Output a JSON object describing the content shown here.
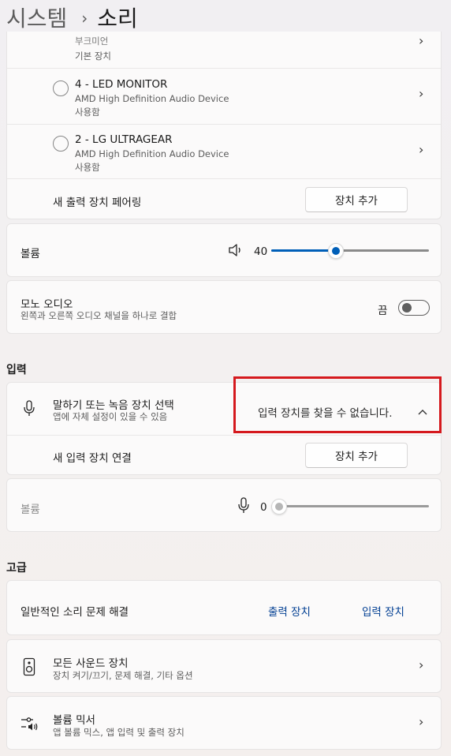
{
  "breadcrumb": {
    "parent": "시스템",
    "separator": "›",
    "current": "소리"
  },
  "output_devices": [
    {
      "name": "부크미언",
      "description": "기본 장치",
      "status": ""
    },
    {
      "name": "4 - LED MONITOR",
      "description": "AMD High Definition Audio Device",
      "status": "사용함"
    },
    {
      "name": "2 - LG ULTRAGEAR",
      "description": "AMD High Definition Audio Device",
      "status": "사용함"
    }
  ],
  "pair_output": {
    "label": "새 출력 장치 페어링",
    "button": "장치 추가"
  },
  "output_volume": {
    "label": "볼륨",
    "value": "40",
    "level": 0.4
  },
  "mono_audio": {
    "label": "모노 오디오",
    "description": "왼쪽과 오른쪽 오디오 채널을 하나로 결합",
    "state": "끔",
    "on": false
  },
  "input_section": {
    "title": "입력",
    "select_label": "말하기 또는 녹음 장치 선택",
    "select_desc": "앱에 자체 설정이 있을 수 있음",
    "no_device": "입력 장치를 찾을 수 없습니다.",
    "connect_label": "새 입력 장치 연결",
    "connect_button": "장치 추가",
    "volume_label": "볼륨",
    "volume_value": "0",
    "volume_level": 0
  },
  "advanced": {
    "title": "고급",
    "troubleshoot_label": "일반적인 소리 문제 해결",
    "output_link": "출력 장치",
    "input_link": "입력 장치",
    "all_devices_label": "모든 사운드 장치",
    "all_devices_desc": "장치 켜기/끄기, 문제 해결, 기타 옵션",
    "mixer_label": "볼륨 믹서",
    "mixer_desc": "앱 볼륨 믹스, 앱 입력 및 출력 장치"
  },
  "colors": {
    "accent": "#005fb8",
    "link": "#003e92",
    "highlight_box": "#d5191e"
  }
}
